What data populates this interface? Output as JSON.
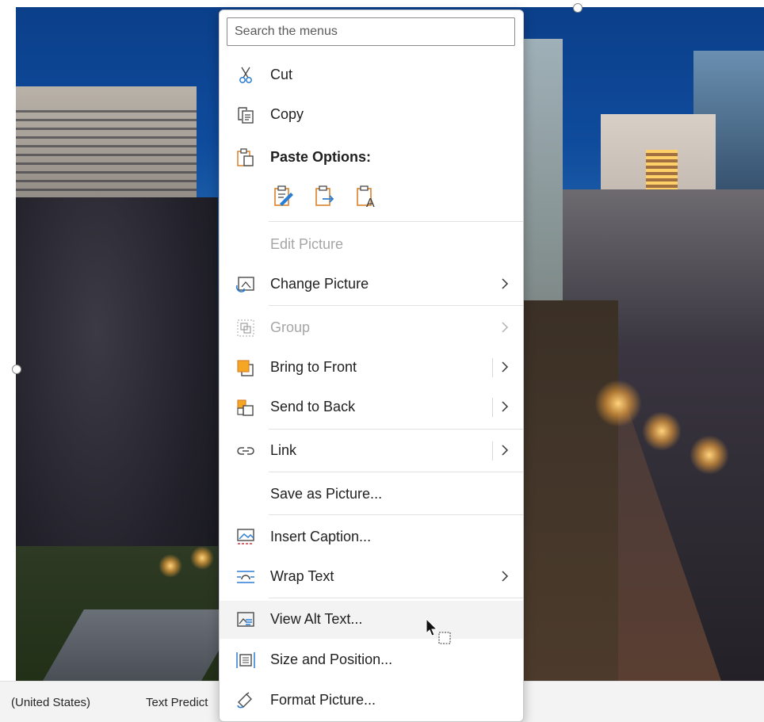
{
  "search": {
    "placeholder": "Search the menus"
  },
  "menu": {
    "cut": "Cut",
    "copy": "Copy",
    "paste_options": "Paste Options:",
    "edit_picture": "Edit Picture",
    "change_picture": "Change Picture",
    "group": "Group",
    "bring_to_front": "Bring to Front",
    "send_to_back": "Send to Back",
    "link": "Link",
    "save_as_picture": "Save as Picture...",
    "insert_caption": "Insert Caption...",
    "wrap_text": "Wrap Text",
    "view_alt_text": "View Alt Text...",
    "size_and_position": "Size and Position...",
    "format_picture": "Format Picture..."
  },
  "statusbar": {
    "language": "(United States)",
    "text_predictions": "Text Predict"
  },
  "icons": {
    "cut": "scissors-icon",
    "copy": "copy-icon",
    "paste": "paste-icon",
    "change_picture": "change-picture-icon",
    "group": "group-icon",
    "bring_to_front": "bring-to-front-icon",
    "send_to_back": "send-to-back-icon",
    "link": "link-icon",
    "insert_caption": "insert-caption-icon",
    "wrap_text": "wrap-text-icon",
    "view_alt_text": "alt-text-icon",
    "size_and_position": "size-position-icon",
    "format_picture": "format-picture-icon"
  },
  "colors": {
    "accent_orange": "#d9822b",
    "accent_blue": "#2b7cd3",
    "disabled": "#a6a6a6"
  }
}
